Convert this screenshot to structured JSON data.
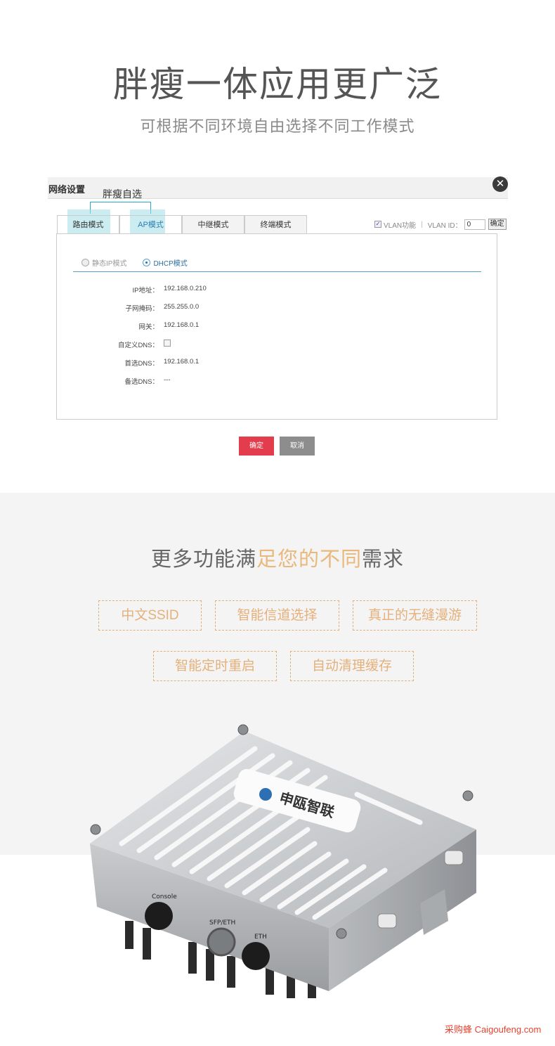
{
  "hero": {
    "title": "胖瘦一体应用更广泛",
    "subtitle": "可根据不同环境自由选择不同工作模式"
  },
  "dialog": {
    "title": "网络设置",
    "callout": "胖瘦自选",
    "tabs": [
      {
        "label": "路由模式"
      },
      {
        "label": "AP模式"
      },
      {
        "label": "中继模式"
      },
      {
        "label": "终端模式"
      }
    ],
    "vlan": {
      "checkbox_label": "VLAN功能",
      "id_label": "VLAN ID：",
      "id_value": "0",
      "ok_label": "确定"
    },
    "radios": [
      {
        "label": "静态IP模式",
        "selected": false
      },
      {
        "label": "DHCP模式",
        "selected": true
      }
    ],
    "fields": {
      "ip": {
        "label": "IP地址：",
        "value": "192.168.0.210"
      },
      "mask": {
        "label": "子网掩码：",
        "value": "255.255.0.0"
      },
      "gateway": {
        "label": "网关：",
        "value": "192.168.0.1"
      },
      "custom_dns": {
        "label": "自定义DNS："
      },
      "dns1": {
        "label": "首选DNS：",
        "value": "192.168.0.1"
      },
      "dns2": {
        "label": "备选DNS：",
        "value": "---"
      }
    },
    "ok_button": "确定",
    "cancel_button": "取消"
  },
  "features": {
    "title_part1": "更多功能满",
    "title_part2": "足您的不同",
    "title_part3": "需求",
    "badges": [
      "中文SSID",
      "智能信道选择",
      "真正的无缝漫游",
      "智能定时重启",
      "自动清理缓存"
    ]
  },
  "device": {
    "brand_text": "申瓯智联",
    "port_labels": [
      "Console",
      "SFP/ETH",
      "ETH"
    ]
  },
  "watermark": "采购蜂 Caigoufeng.com",
  "colors": {
    "accent_red": "#e33d4d",
    "cancel_grey": "#8d8d8d",
    "badge_gold": "#e5b07a",
    "tab_highlight": "#ccedf2",
    "link_blue": "#2c6e9e"
  }
}
